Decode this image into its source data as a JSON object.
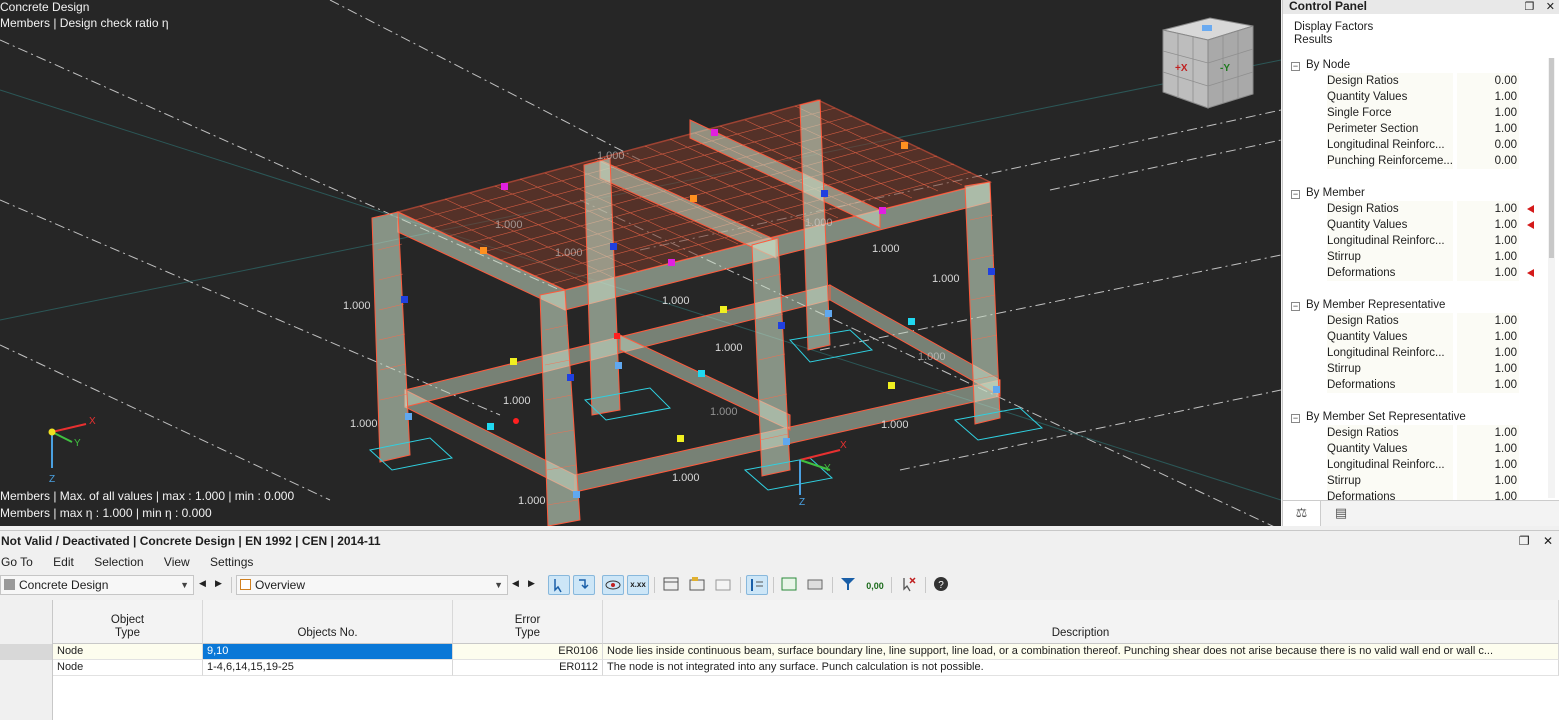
{
  "viewport": {
    "title_line1": "Concrete Design",
    "title_line2": "Members | Design check ratio η",
    "footer_line1": "Members | Max. of all values | max  : 1.000 | min  : 0.000",
    "footer_line2": "Members | max η : 1.000 | min η : 0.000",
    "value_labels": [
      "1.000",
      "1.000",
      "1.000",
      "1.000",
      "1.000",
      "1.000",
      "1.000",
      "1.000",
      "1.000",
      "1.000",
      "1.000",
      "1.000",
      "1.000",
      "1.000",
      "1.000",
      "1.000"
    ],
    "axis_labels": {
      "x": "X",
      "y": "Y",
      "z": "Z"
    },
    "navcube": {
      "left_face": "+X",
      "right_face": "-Y"
    }
  },
  "control_panel": {
    "title": "Control Panel",
    "header_line1": "Display Factors",
    "header_line2": "Results",
    "groups": [
      {
        "name": "By Node",
        "items": [
          {
            "label": "Design Ratios",
            "value": "0.00",
            "flag": false
          },
          {
            "label": "Quantity Values",
            "value": "1.00",
            "flag": false
          },
          {
            "label": "Single Force",
            "value": "1.00",
            "flag": false
          },
          {
            "label": "Perimeter Section",
            "value": "1.00",
            "flag": false
          },
          {
            "label": "Longitudinal Reinforc...",
            "value": "0.00",
            "flag": false
          },
          {
            "label": "Punching Reinforceme...",
            "value": "0.00",
            "flag": false
          }
        ]
      },
      {
        "name": "By Member",
        "items": [
          {
            "label": "Design Ratios",
            "value": "1.00",
            "flag": true
          },
          {
            "label": "Quantity Values",
            "value": "1.00",
            "flag": true
          },
          {
            "label": "Longitudinal Reinforc...",
            "value": "1.00",
            "flag": false
          },
          {
            "label": "Stirrup",
            "value": "1.00",
            "flag": false
          },
          {
            "label": "Deformations",
            "value": "1.00",
            "flag": true
          }
        ]
      },
      {
        "name": "By Member Representative",
        "items": [
          {
            "label": "Design Ratios",
            "value": "1.00",
            "flag": false
          },
          {
            "label": "Quantity Values",
            "value": "1.00",
            "flag": false
          },
          {
            "label": "Longitudinal Reinforc...",
            "value": "1.00",
            "flag": false
          },
          {
            "label": "Stirrup",
            "value": "1.00",
            "flag": false
          },
          {
            "label": "Deformations",
            "value": "1.00",
            "flag": false
          }
        ]
      },
      {
        "name": "By Member Set Representative",
        "items": [
          {
            "label": "Design Ratios",
            "value": "1.00",
            "flag": false
          },
          {
            "label": "Quantity Values",
            "value": "1.00",
            "flag": false
          },
          {
            "label": "Longitudinal Reinforc...",
            "value": "1.00",
            "flag": false
          },
          {
            "label": "Stirrup",
            "value": "1.00",
            "flag": false
          },
          {
            "label": "Deformations",
            "value": "1.00",
            "flag": false
          }
        ]
      }
    ]
  },
  "bottom_panel": {
    "title": "Not Valid / Deactivated | Concrete Design | EN 1992 | CEN | 2014-11",
    "menu": [
      "Go To",
      "Edit",
      "Selection",
      "View",
      "Settings"
    ],
    "combo_module": "Concrete Design",
    "combo_view": "Overview",
    "toolbar_value_icon_text": "0,00",
    "toolbar_xxx_text": "x.xx",
    "table": {
      "headers": [
        {
          "line1": "Object",
          "line2": "Type"
        },
        {
          "line1": "",
          "line2": "Objects No."
        },
        {
          "line1": "Error",
          "line2": "Type"
        },
        {
          "line1": "",
          "line2": "Description"
        }
      ],
      "rows": [
        {
          "object_type": "Node",
          "objects_no": "9,10",
          "error_type": "ER0106",
          "description": "Node lies inside continuous beam, surface boundary line, line support, line load, or a combination thereof. Punching shear does not arise because there is no valid wall end or wall c..."
        },
        {
          "object_type": "Node",
          "objects_no": "1-4,6,14,15,19-25",
          "error_type": "ER0112",
          "description": "The node is not integrated into any surface. Punch calculation is not possible."
        }
      ]
    }
  },
  "colors": {
    "viewport_bg": "#262626",
    "member_fill": "#c8dcc4",
    "reinforcement": "#e8543a",
    "selection": "#0a78d7",
    "flag": "#d41a1a"
  }
}
